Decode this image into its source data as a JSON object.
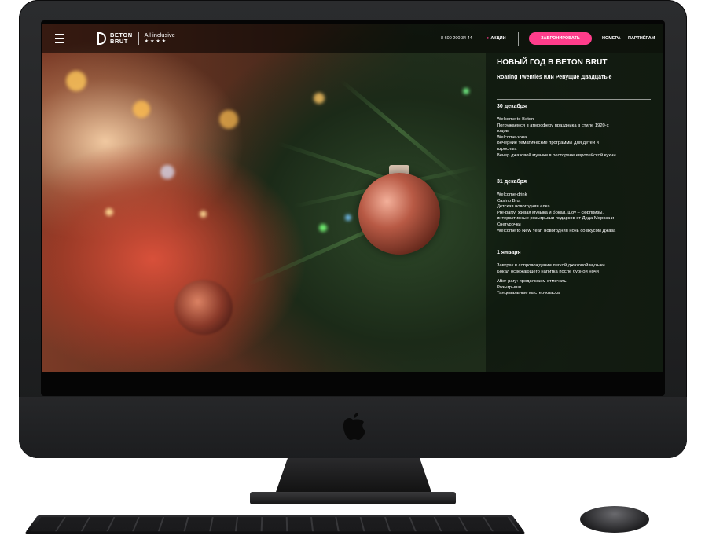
{
  "header": {
    "logo_line1": "BETON",
    "logo_line2": "BRUT",
    "tagline": "All inclusive",
    "stars": "★★★★",
    "phone": "8 600 200 34 44",
    "promo_label": "АКЦИИ",
    "book_label": "ЗАБРОНИРОВАТЬ",
    "rooms_label": "НОМЕРА",
    "partners_label": "ПАРТНЁРАМ"
  },
  "colors": {
    "accent": "#ff3d8b"
  },
  "icons": {
    "menu": "hamburger-icon",
    "logo": "beton-brut-logo-icon",
    "device": "apple-logo-icon"
  },
  "event": {
    "title": "НОВЫЙ ГОД В BETON BRUT",
    "subtitle": "Roaring Twenties или Ревущие Двадцатые",
    "days": [
      {
        "date": "30 декабря",
        "items": [
          "Welcome to Beton",
          "Погружаемся в атмосферу праздника в стиле 1920-х",
          "годов",
          "Welcome-зона",
          "Вечерние тематические программы для детей и",
          "взрослых",
          "Вечер джазовой музыки в ресторане европейской кухни"
        ]
      },
      {
        "date": "31 декабря",
        "items": [
          "Welcome-drink",
          "Casino Brut",
          "Детская новогодняя елка",
          "Pre-party: живая музыка и бокал, шоу – сюрпризы,",
          "интерактивные розыгрыши подарков от Деда Мороза и",
          "Снегурочки",
          "Welcome to New Year: новогодняя ночь со вкусом Джаза"
        ]
      },
      {
        "date": "1 января",
        "items": [
          "Завтрак в сопровождении легкой джазовой музыки",
          "Бокал освежающего напитка после бурной ночи",
          "",
          "After-pary: продолжаем отмечать",
          "Розыгрыши",
          "Танцевальные мастер-классы"
        ]
      }
    ]
  }
}
